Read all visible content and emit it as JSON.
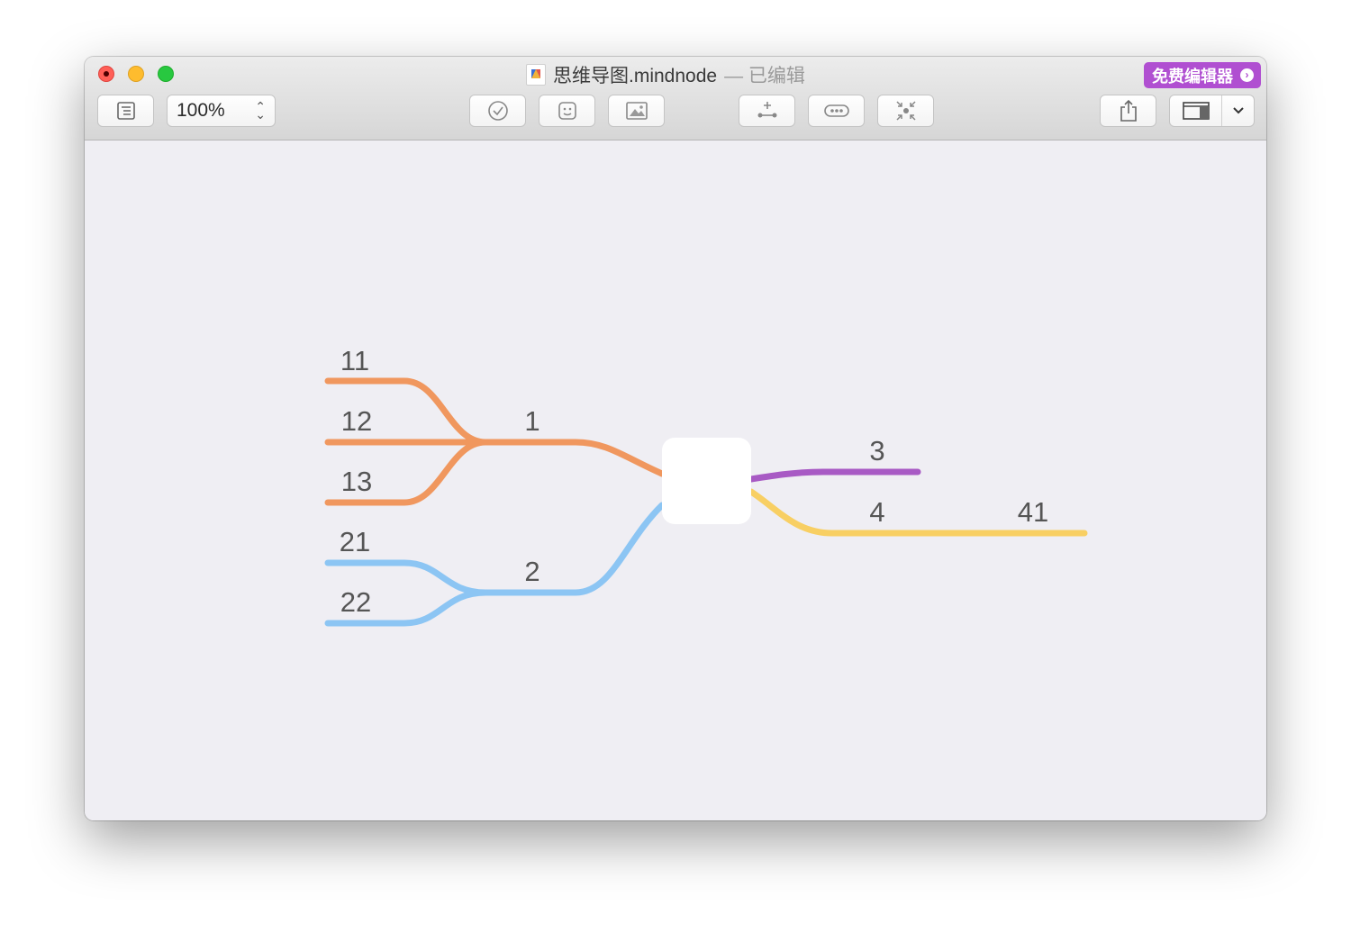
{
  "window": {
    "title_file": "思维导图.mindnode",
    "title_status": "— 已编辑",
    "promo_label": "免费编辑器",
    "promo_color": "#b04fd1"
  },
  "toolbar": {
    "zoom_value": "100%",
    "buttons": [
      "outline-icon",
      "task-checkmark-icon",
      "sticker-icon",
      "image-icon",
      "add-child-node-icon",
      "connect-icon",
      "focus-icon",
      "share-icon",
      "inspector-panel-icon",
      "chevron-down-icon"
    ]
  },
  "mindmap": {
    "central": "",
    "branch_colors": {
      "orange": "#f0975e",
      "blue": "#8cc5f3",
      "purple": "#a85ac4",
      "yellow": "#f8cf63"
    },
    "nodes": {
      "n1": "1",
      "n11": "11",
      "n12": "12",
      "n13": "13",
      "n2": "2",
      "n21": "21",
      "n22": "22",
      "n3": "3",
      "n4": "4",
      "n41": "41"
    }
  }
}
